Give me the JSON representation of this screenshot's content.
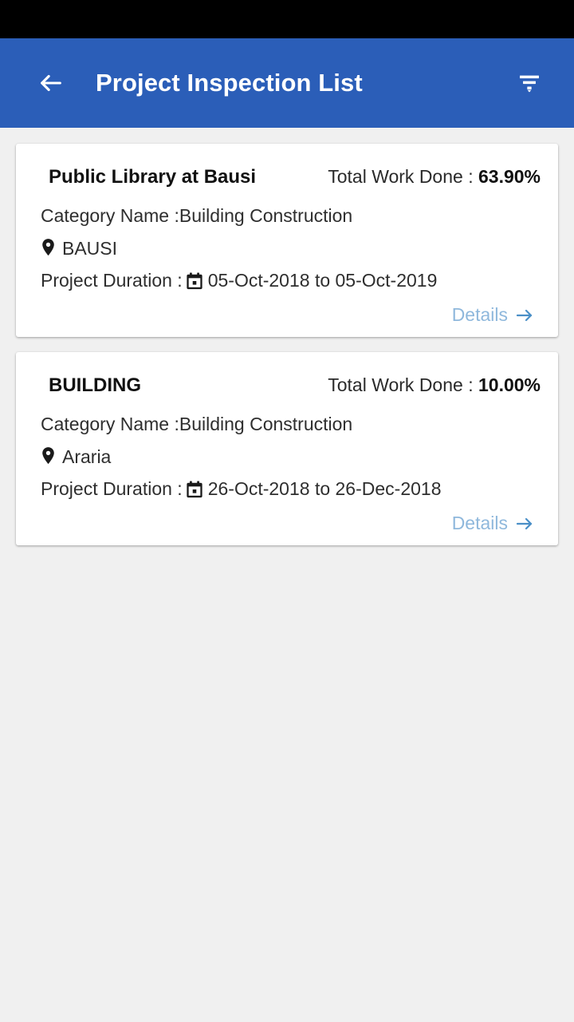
{
  "status_bar": {
    "background": "#000000"
  },
  "app_bar": {
    "title": "Project Inspection List",
    "background": "#2b5eb8",
    "back_icon": "arrow-left-icon",
    "filter_icon": "filter-icon"
  },
  "labels": {
    "work_done_prefix": "Total Work Done : ",
    "category_prefix": "Category Name : ",
    "duration_prefix": "Project Duration : ",
    "details": "Details",
    "details_arrow_icon": "arrow-right-icon",
    "location_icon": "map-pin-icon",
    "calendar_icon": "calendar-icon"
  },
  "colors": {
    "primary": "#2b5eb8",
    "page_background": "#f0f0f0",
    "card_background": "#ffffff",
    "details_text": "#8fb8dc",
    "details_arrow": "#4a8fc7",
    "text": "#2e2e2e"
  },
  "cards": [
    {
      "project_name": "Public Library at Bausi",
      "work_done_value": "63.90%",
      "category": "Building Construction",
      "location": "BAUSI",
      "duration": "05-Oct-2018 to 05-Oct-2019"
    },
    {
      "project_name": "BUILDING",
      "work_done_value": "10.00%",
      "category": "Building Construction",
      "location": "Araria",
      "duration": "26-Oct-2018 to 26-Dec-2018"
    }
  ]
}
